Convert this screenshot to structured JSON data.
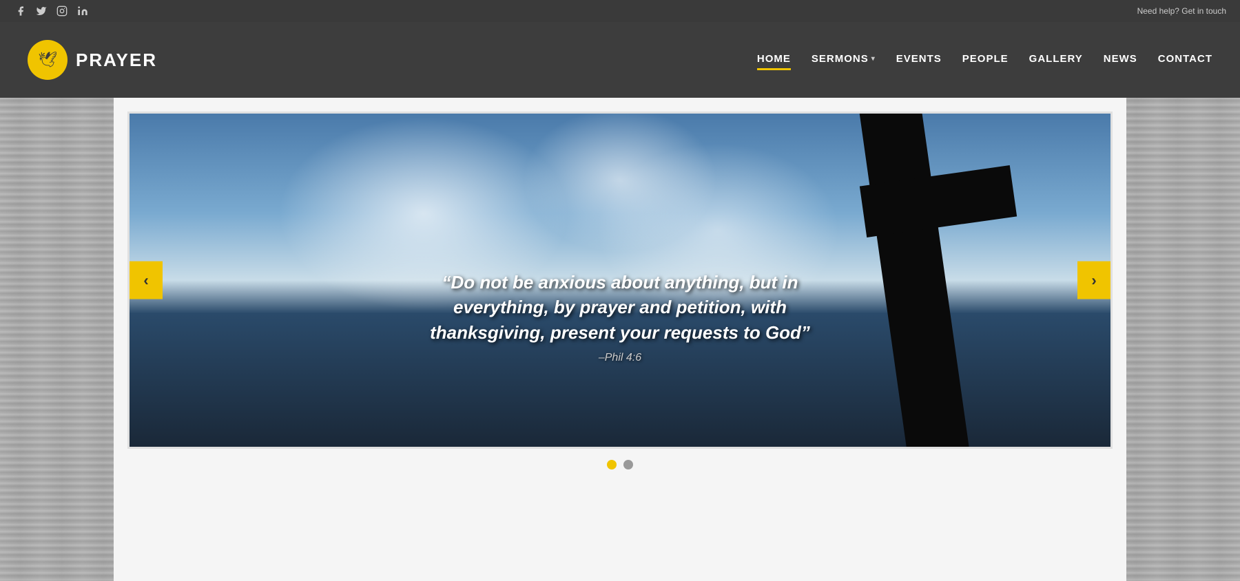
{
  "topbar": {
    "help_text": "Need help? Get in touch",
    "social": [
      {
        "name": "facebook",
        "icon": "f"
      },
      {
        "name": "twitter",
        "icon": "t"
      },
      {
        "name": "instagram",
        "icon": "i"
      },
      {
        "name": "linkedin",
        "icon": "in"
      }
    ]
  },
  "header": {
    "logo_text": "PRAYER",
    "nav": [
      {
        "label": "HOME",
        "active": true,
        "has_dropdown": false
      },
      {
        "label": "SERMONS",
        "active": false,
        "has_dropdown": true
      },
      {
        "label": "EVENTS",
        "active": false,
        "has_dropdown": false
      },
      {
        "label": "PEOPLE",
        "active": false,
        "has_dropdown": false
      },
      {
        "label": "GALLERY",
        "active": false,
        "has_dropdown": false
      },
      {
        "label": "NEWS",
        "active": false,
        "has_dropdown": false
      },
      {
        "label": "CONTACT",
        "active": false,
        "has_dropdown": false
      }
    ]
  },
  "slider": {
    "prev_label": "‹",
    "next_label": "›",
    "quote": "“Do not be anxious about anything, but in everything, by prayer and petition, with thanksgiving, present your requests to God”",
    "reference": "–Phil 4:6",
    "dots": [
      {
        "active": true
      },
      {
        "active": false
      }
    ]
  }
}
